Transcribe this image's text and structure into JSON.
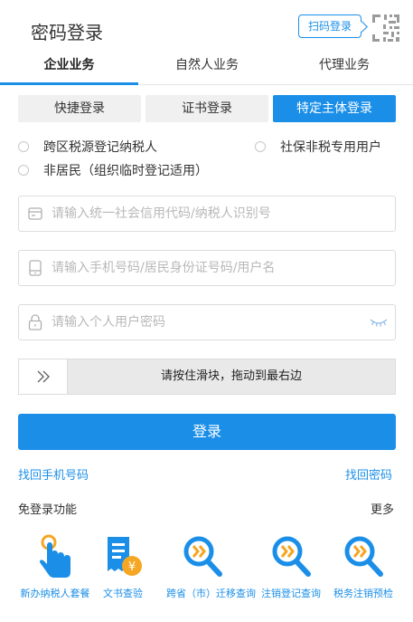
{
  "header": {
    "title": "密码登录",
    "qr_button": "扫码登录"
  },
  "tabs": [
    "企业业务",
    "自然人业务",
    "代理业务"
  ],
  "subtabs": [
    "快捷登录",
    "证书登录",
    "特定主体登录"
  ],
  "radios": [
    "跨区税源登记纳税人",
    "社保非税专用用户",
    "非居民（组织临时登记适用）"
  ],
  "fields": {
    "credit_code_placeholder": "请输入统一社会信用代码/纳税人识别号",
    "phone_placeholder": "请输入手机号码/居民身份证号码/用户名",
    "password_placeholder": "请输入个人用户密码"
  },
  "slider": {
    "text": "请按住滑块，拖动到最右边"
  },
  "login_button": "登录",
  "links": {
    "recover_phone": "找回手机号码",
    "recover_password": "找回密码"
  },
  "quick": {
    "label": "免登录功能",
    "more": "更多",
    "items": [
      "新办纳税人套餐",
      "文书查验",
      "跨省（市）迁移查询",
      "注销登记查询",
      "税务注销预检"
    ]
  },
  "colors": {
    "accent": "#1b8fe8",
    "secondary_accent": "#f5a623"
  }
}
